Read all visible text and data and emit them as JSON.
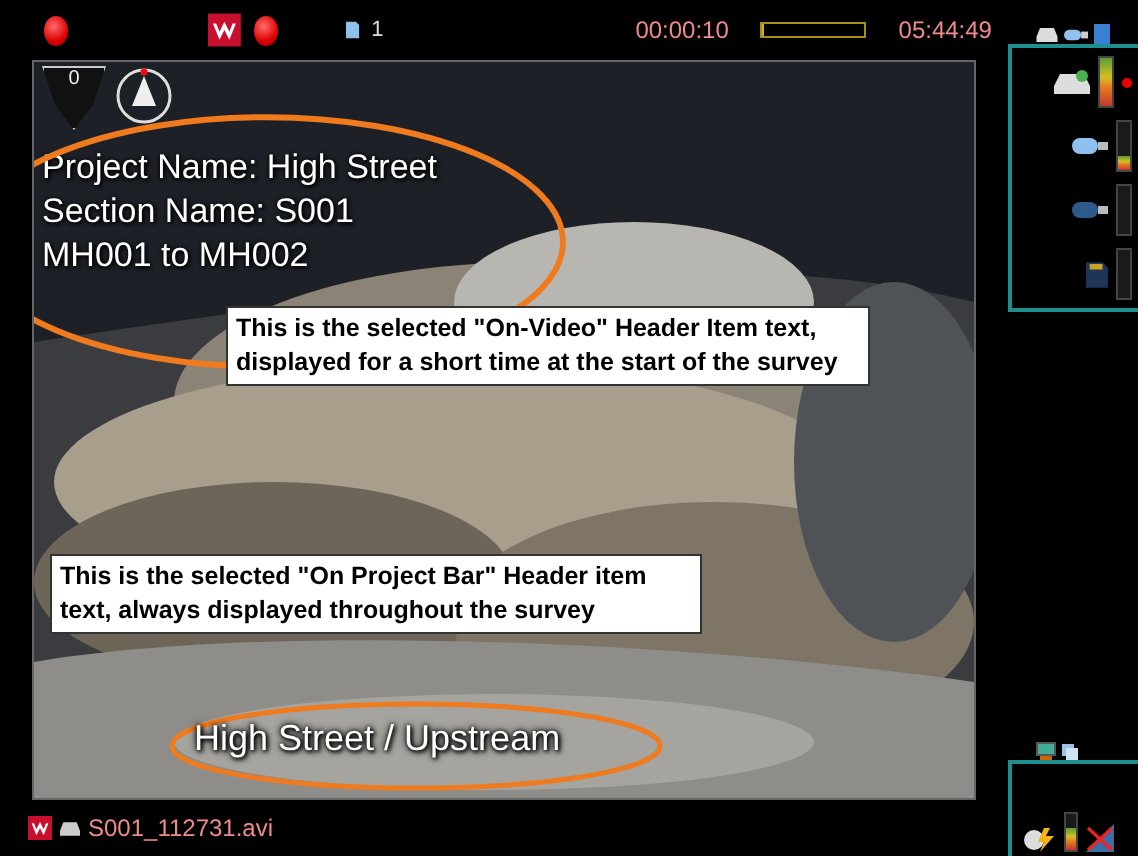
{
  "top_bar": {
    "page_number": "1",
    "elapsed_time": "00:00:10",
    "progress": {
      "level": 0.02
    },
    "total_time": "05:44:49"
  },
  "counter": "0",
  "video_header": [
    "Project Name: High Street",
    "Section Name: S001",
    "MH001 to MH002"
  ],
  "callouts": [
    {
      "text": "This is the selected \"On-Video\" Header Item text, displayed for a short time at the start of the survey"
    },
    {
      "text": "This is the selected \"On Project Bar\" Header item text, always displayed throughout the survey"
    }
  ],
  "project_bar": "High Street / Upstream",
  "file_name": "S001_112731.avi",
  "storage": [
    {
      "kind": "disk",
      "level": 1
    },
    {
      "kind": "usb",
      "level": 0.3
    },
    {
      "kind": "usb"
    },
    {
      "kind": "sd"
    }
  ],
  "battery": {
    "level": 0.6
  }
}
